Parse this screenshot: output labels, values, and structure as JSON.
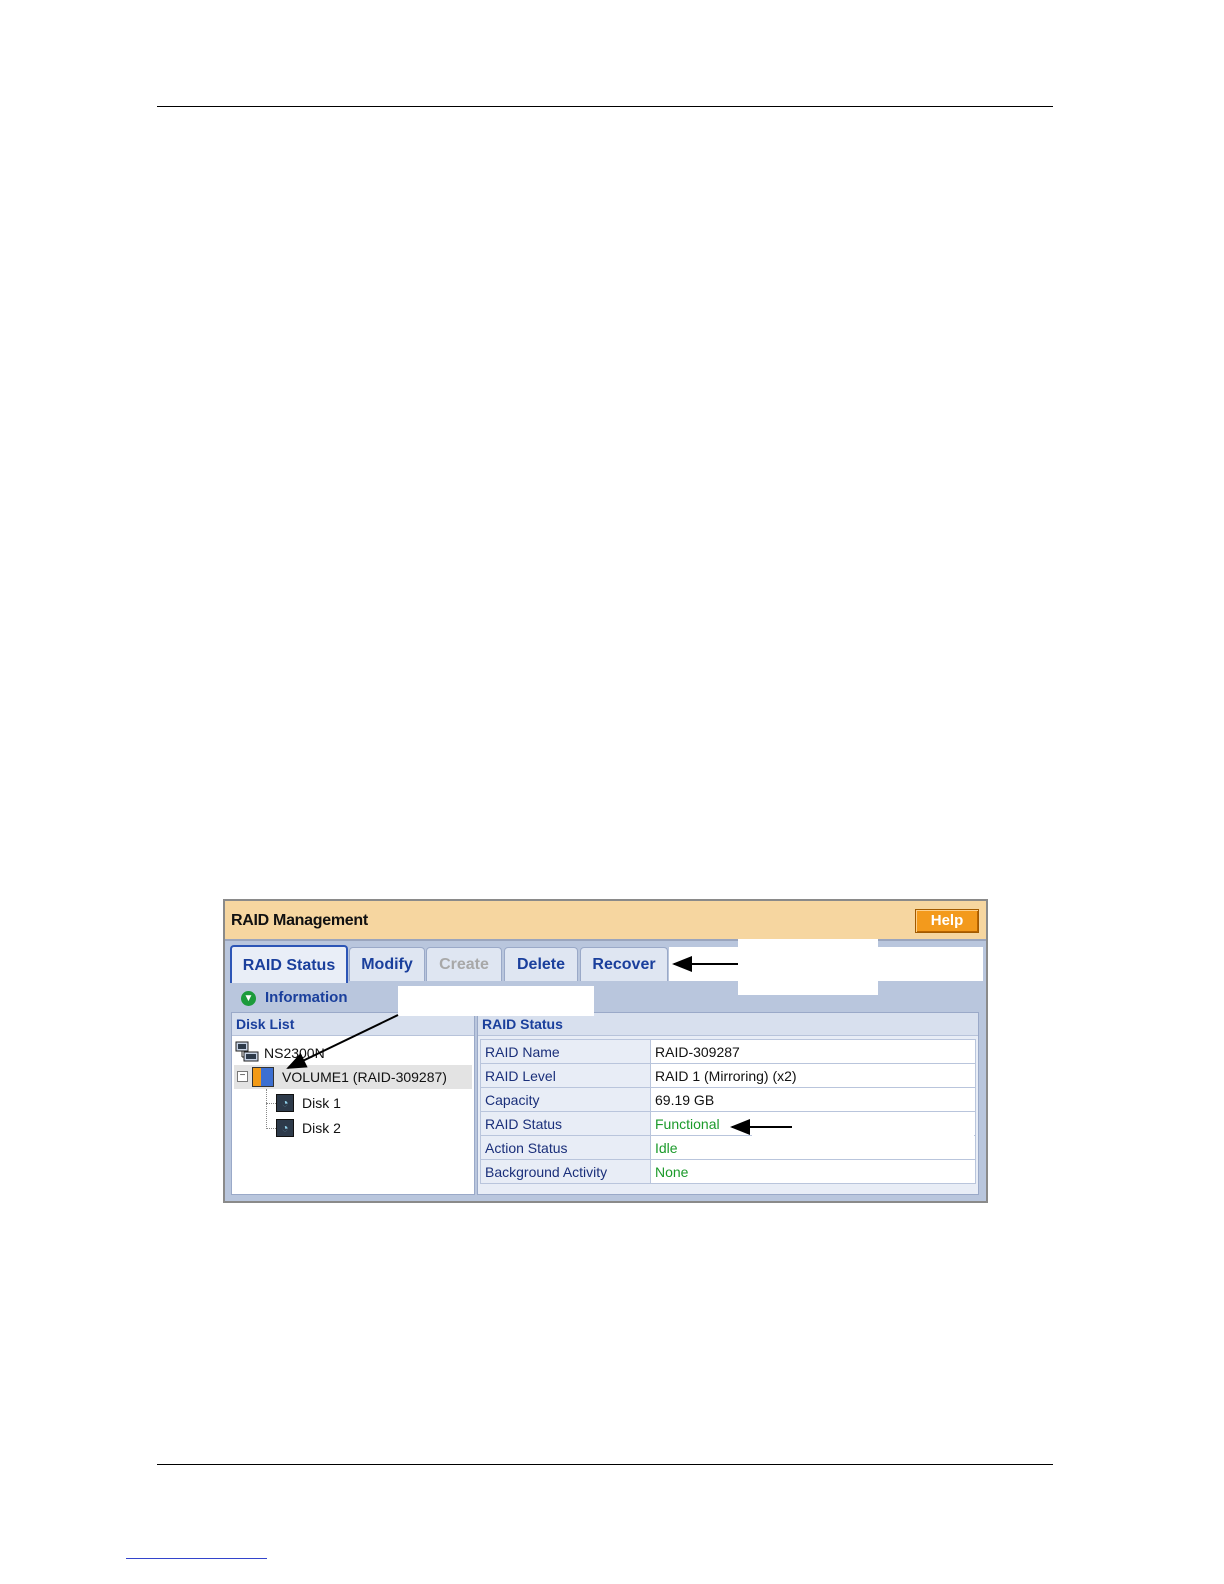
{
  "panel": {
    "title": "RAID Management",
    "help_label": "Help"
  },
  "tabs": [
    {
      "label": "RAID Status",
      "state": "active"
    },
    {
      "label": "Modify",
      "state": "enabled"
    },
    {
      "label": "Create",
      "state": "disabled"
    },
    {
      "label": "Delete",
      "state": "enabled"
    },
    {
      "label": "Recover",
      "state": "enabled"
    }
  ],
  "information": {
    "label": "Information",
    "icon": "chevron-down-circle-icon"
  },
  "disk_list": {
    "header": "Disk List",
    "root": "NS2300N",
    "volume": "VOLUME1 (RAID-309287)",
    "disks": [
      "Disk 1",
      "Disk 2"
    ]
  },
  "raid_status": {
    "header": "RAID Status",
    "rows": [
      {
        "key": "RAID Name",
        "value": "RAID-309287"
      },
      {
        "key": "RAID Level",
        "value": "RAID 1 (Mirroring) (x2)"
      },
      {
        "key": "Capacity",
        "value": "69.19 GB"
      },
      {
        "key": "RAID Status",
        "value": "Functional"
      },
      {
        "key": "Action Status",
        "value": "Idle"
      },
      {
        "key": "Background Activity",
        "value": "None"
      }
    ]
  },
  "colors": {
    "titlebar": "#f6d6a0",
    "help_button": "#f39a1c",
    "tab_text": "#1a3f9c",
    "status_ok": "#1b9a2a"
  }
}
